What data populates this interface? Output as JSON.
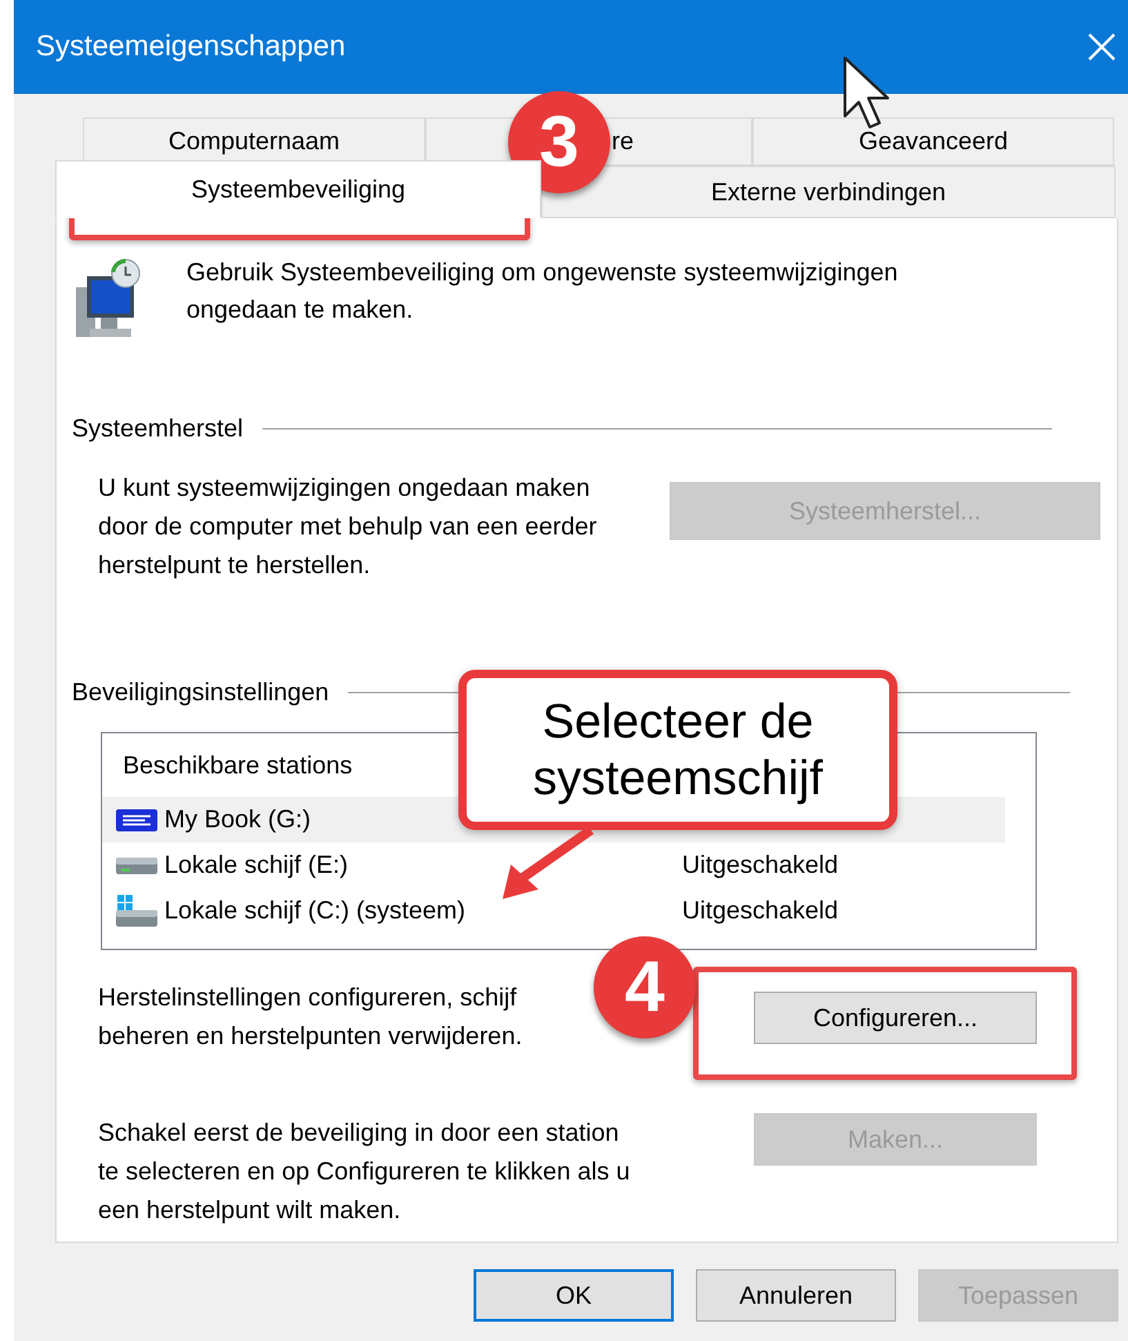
{
  "window": {
    "title": "Systeemeigenschappen"
  },
  "tab_rows": [
    [
      {
        "label": "Computernaam",
        "selected": false
      },
      {
        "label": "re",
        "selected": false
      },
      {
        "label": "Geavanceerd",
        "selected": false
      }
    ],
    [
      {
        "label": "Systeembeveiliging",
        "selected": true
      },
      {
        "label": "Externe verbindingen",
        "selected": false
      }
    ]
  ],
  "intro": "Gebruik Systeembeveiliging om ongewenste systeemwijzigingen ongedaan te maken.",
  "restore": {
    "heading": "Systeemherstel",
    "text": "U kunt systeemwijzigingen ongedaan maken door de computer met behulp van een eerder herstelpunt te herstellen.",
    "button": {
      "label": "Systeemherstel...",
      "disabled": true
    }
  },
  "protection": {
    "heading": "Beveiligingsinstellingen",
    "list": {
      "column": "Beschikbare stations",
      "rows": [
        {
          "kind": "external",
          "name": "My Book (G:)",
          "highlighted": true
        },
        {
          "kind": "drive",
          "name": "Lokale schijf (E:)",
          "status": "Uitgeschakeld",
          "highlighted": false
        },
        {
          "kind": "system",
          "name": "Lokale schijf (C:) (systeem)",
          "status": "Uitgeschakeld",
          "highlighted": false
        }
      ]
    },
    "configure": {
      "text": "Herstelinstellingen configureren, schijf",
      "text2": "beheren en herstelpunten verwijderen.",
      "button": {
        "label": "Configureren...",
        "disabled": false
      }
    },
    "create": {
      "text": "Schakel eerst de beveiliging in door een station te selecteren en op Configureren te klikken als u een herstelpunt wilt maken.",
      "button": {
        "label": "Maken...",
        "disabled": true
      }
    }
  },
  "footer_buttons": [
    {
      "label": "OK",
      "default": true,
      "disabled": false
    },
    {
      "label": "Annuleren",
      "default": false,
      "disabled": false
    },
    {
      "label": "Toepassen",
      "default": false,
      "disabled": true
    }
  ],
  "annotations": [
    {
      "kind": "badge",
      "label": "3"
    },
    {
      "kind": "callout",
      "text": "Selecteer de systeemschijf"
    },
    {
      "kind": "badge",
      "label": "4"
    }
  ]
}
